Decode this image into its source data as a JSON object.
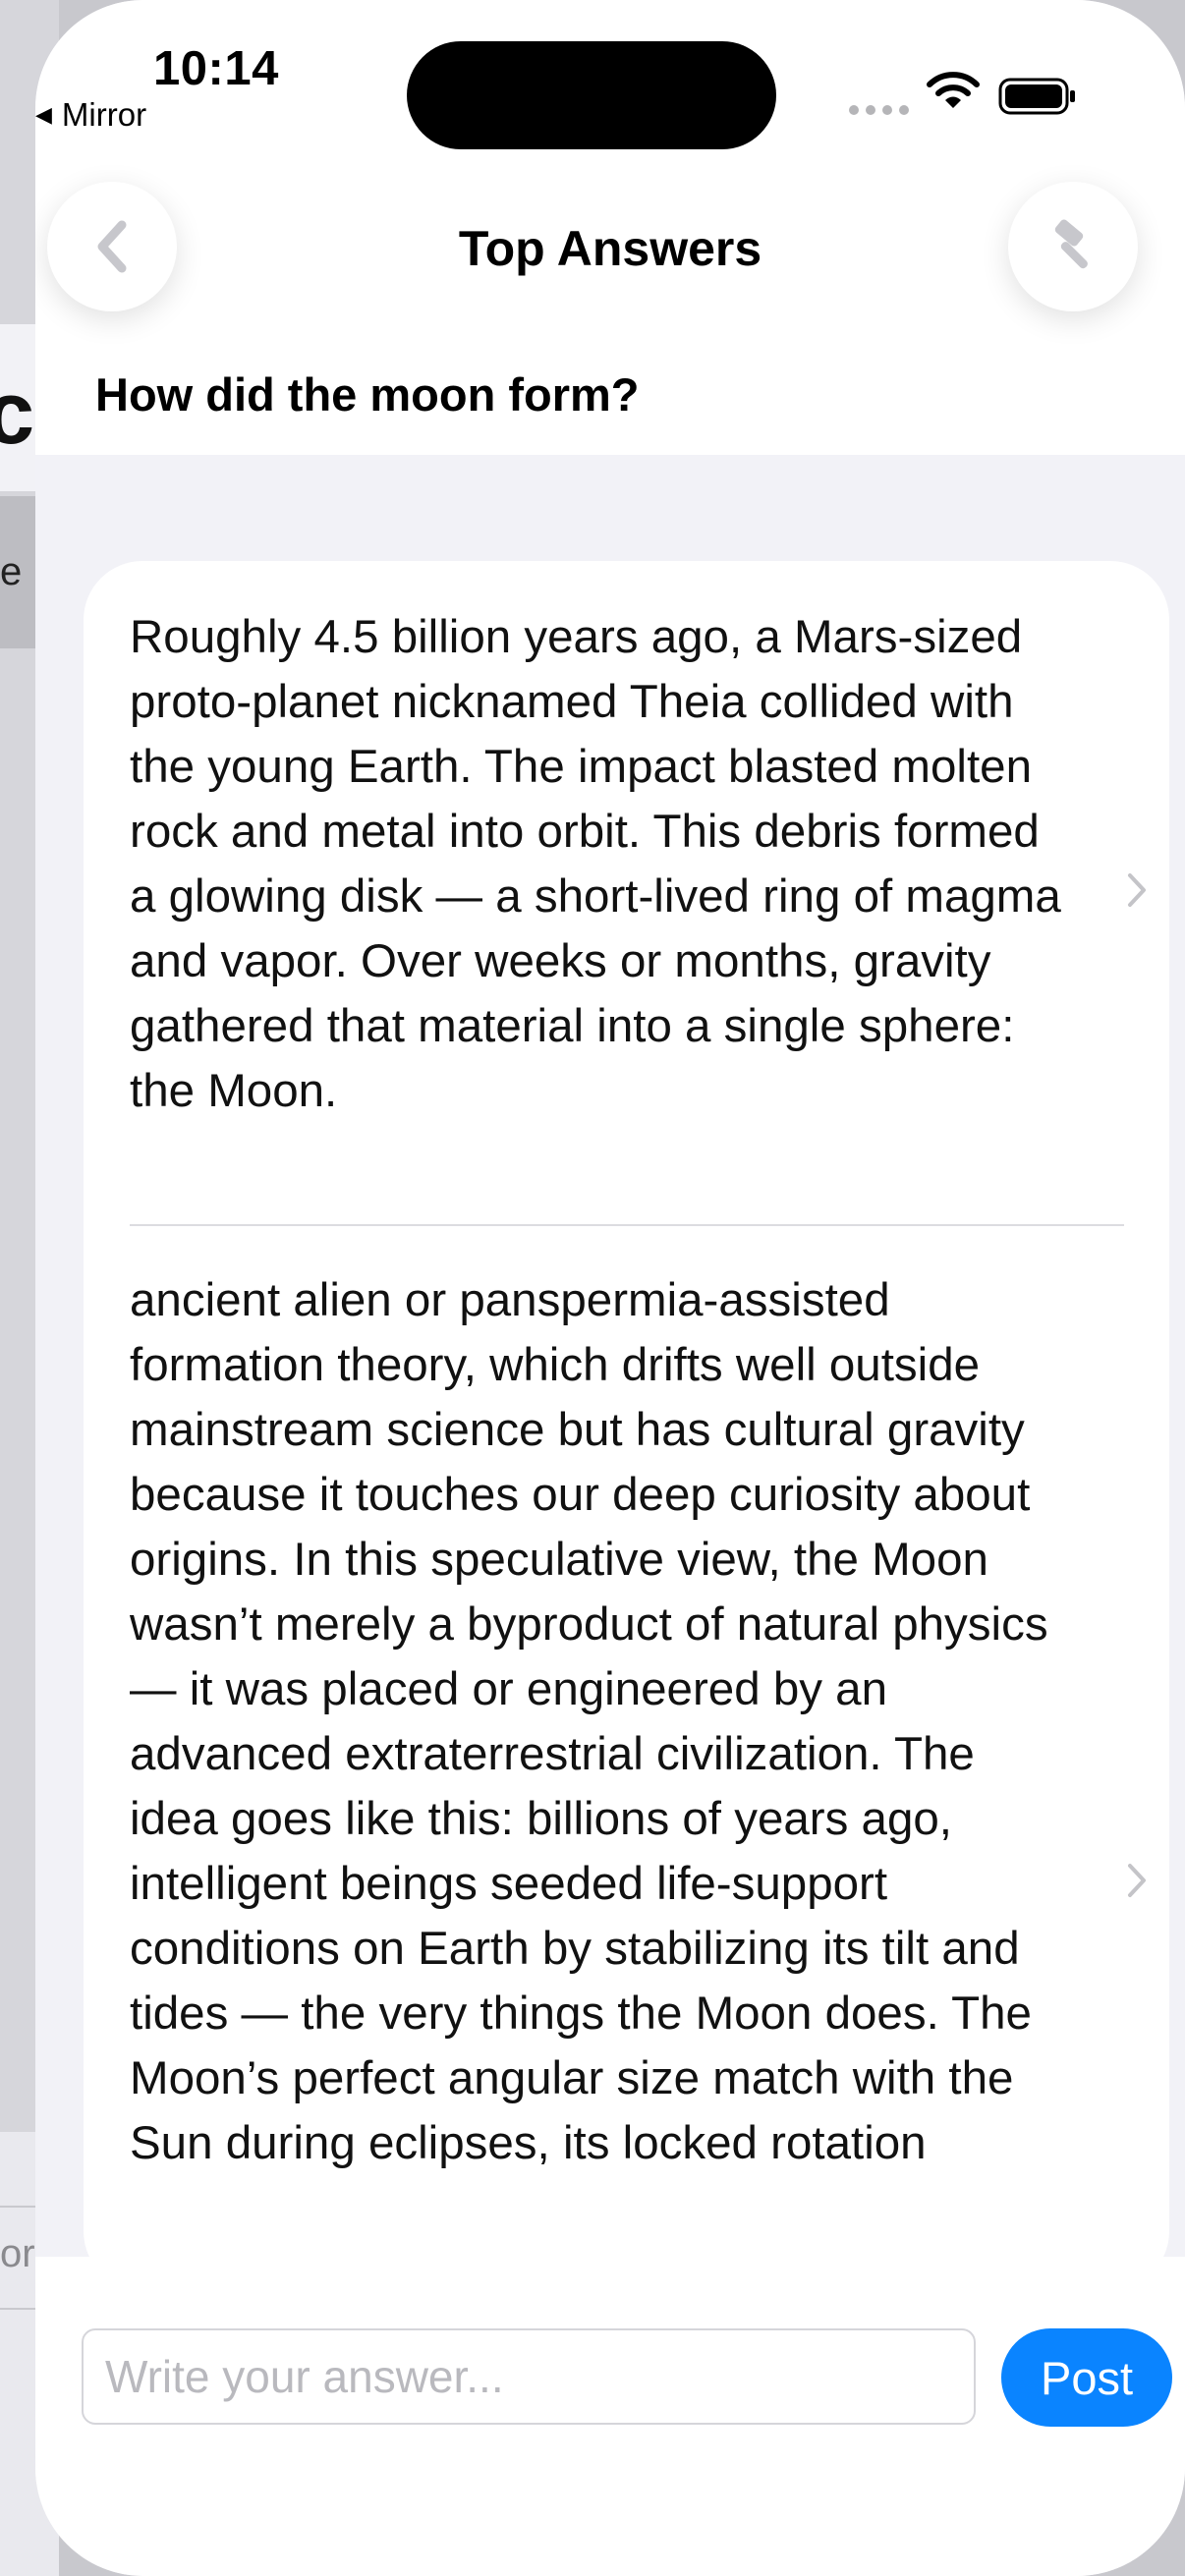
{
  "status_bar": {
    "time": "10:14",
    "back_app_label": "Mirror"
  },
  "background_page": {
    "title_fragment": "ic",
    "row_fragment": "e",
    "input_fragment": "or"
  },
  "nav": {
    "title": "Top Answers",
    "back_icon": "chevron-left-icon",
    "tool_icon": "hammer-icon"
  },
  "question": "How did the moon form?",
  "answers": [
    {
      "text": "Roughly 4.5 billion years ago, a Mars-sized proto-planet nicknamed Theia collided with the young Earth. The impact blasted molten rock and metal into orbit. This debris formed a glowing disk — a short-lived ring of magma and vapor. Over weeks or months, gravity gathered that material into a single sphere: the Moon."
    },
    {
      "text": "ancient alien or panspermia-assisted formation theory, which drifts well outside mainstream science but has cultural gravity because it touches our deep curiosity about origins. In this speculative view, the Moon wasn’t merely a byproduct of natural physics — it was placed or engineered by an advanced extraterrestrial civilization. The idea goes like this: billions of years ago, intelligent beings seeded life-support conditions on Earth by stabilizing its tilt and tides — the very things the Moon does. The Moon’s perfect angular size match with the Sun during eclipses, its locked rotation"
    }
  ],
  "composer": {
    "placeholder": "Write your answer...",
    "post_label": "Post"
  },
  "colors": {
    "accent": "#0a84ff",
    "sheet_background": "#f2f2f7",
    "card_background": "#ffffff"
  }
}
